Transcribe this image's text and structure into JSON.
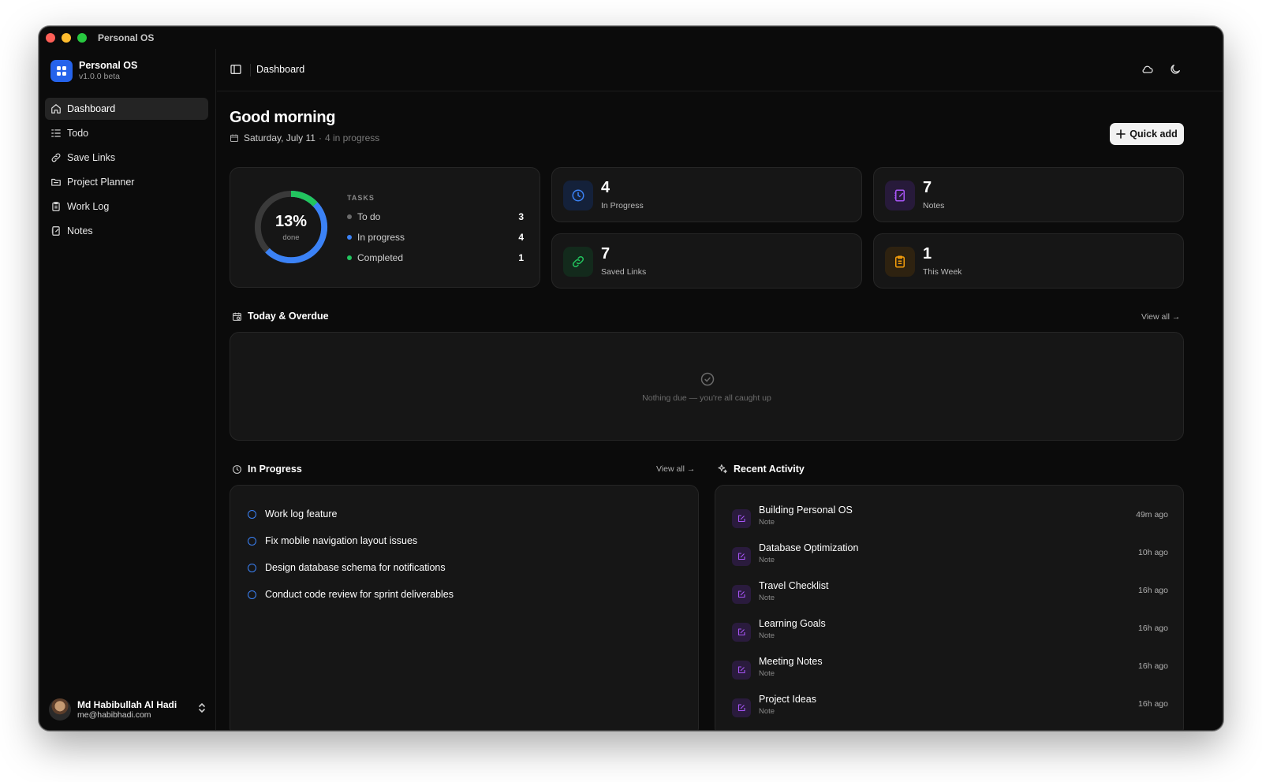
{
  "window": {
    "title": "Personal OS"
  },
  "sidebar": {
    "brand_name": "Personal OS",
    "brand_version": "v1.0.0 beta",
    "items": [
      {
        "label": "Dashboard",
        "icon": "home-icon"
      },
      {
        "label": "Todo",
        "icon": "list-todo-icon"
      },
      {
        "label": "Save Links",
        "icon": "link-icon"
      },
      {
        "label": "Project Planner",
        "icon": "folder-icon"
      },
      {
        "label": "Work Log",
        "icon": "clipboard-icon"
      },
      {
        "label": "Notes",
        "icon": "notes-icon"
      }
    ],
    "user": {
      "name": "Md Habibullah Al Hadi",
      "email": "me@habibhadi.com"
    }
  },
  "topbar": {
    "title": "Dashboard"
  },
  "header": {
    "greeting": "Good morning",
    "date": "Saturday, July 11",
    "separator": "·",
    "in_progress_summary": "4 in progress",
    "quick_add_label": "Quick add"
  },
  "tasks_card": {
    "percent_label": "13%",
    "done_label": "done",
    "heading": "TASKS",
    "progress_fraction": 0.13,
    "rows": [
      {
        "label": "To do",
        "count": "3",
        "color": "#6b6b6b"
      },
      {
        "label": "In progress",
        "count": "4",
        "color": "#3b82f6"
      },
      {
        "label": "Completed",
        "count": "1",
        "color": "#22c55e"
      }
    ]
  },
  "stats": [
    {
      "value": "4",
      "label": "In Progress",
      "icon": "clock-icon",
      "color": "#3b82f6"
    },
    {
      "value": "7",
      "label": "Notes",
      "icon": "notes-icon",
      "color": "#a855f7"
    },
    {
      "value": "7",
      "label": "Saved Links",
      "icon": "link-icon",
      "color": "#22c55e"
    },
    {
      "value": "1",
      "label": "This Week",
      "icon": "clipboard-icon",
      "color": "#f59e0b"
    }
  ],
  "today": {
    "title": "Today & Overdue",
    "view_all": "View all →",
    "empty_text": "Nothing due — you're all caught up"
  },
  "in_progress": {
    "title": "In Progress",
    "view_all": "View all →",
    "items": [
      "Work log feature",
      "Fix mobile navigation layout issues",
      "Design database schema for notifications",
      "Conduct code review for sprint deliverables"
    ]
  },
  "recent_activity": {
    "title": "Recent Activity",
    "items": [
      {
        "title": "Building Personal OS",
        "type": "Note",
        "time": "49m ago"
      },
      {
        "title": "Database Optimization",
        "type": "Note",
        "time": "10h ago"
      },
      {
        "title": "Travel Checklist",
        "type": "Note",
        "time": "16h ago"
      },
      {
        "title": "Learning Goals",
        "type": "Note",
        "time": "16h ago"
      },
      {
        "title": "Meeting Notes",
        "type": "Note",
        "time": "16h ago"
      },
      {
        "title": "Project Ideas",
        "type": "Note",
        "time": "16h ago"
      }
    ]
  }
}
